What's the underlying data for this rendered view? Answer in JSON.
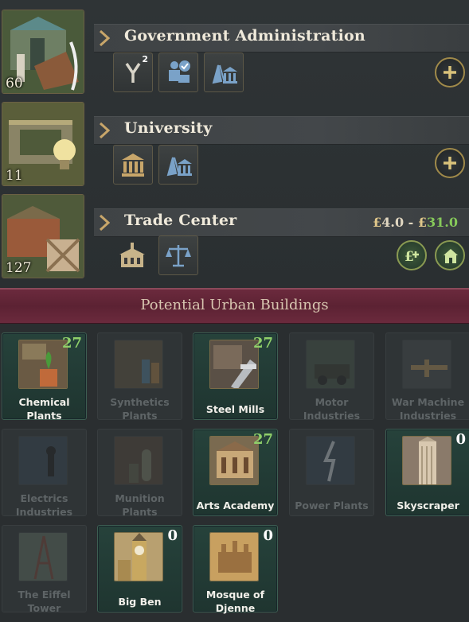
{
  "built": [
    {
      "name": "Government Administration",
      "level": "60",
      "actions": [
        {
          "icon": "branch-icon",
          "badge": "2"
        },
        {
          "icon": "worker-check-icon"
        },
        {
          "icon": "pray-institution-icon"
        }
      ],
      "right": [
        {
          "icon": "plus-icon",
          "style": "gold"
        }
      ]
    },
    {
      "name": "University",
      "level": "11",
      "actions": [
        {
          "icon": "institution-icon"
        },
        {
          "icon": "pray-institution-icon"
        }
      ],
      "right": [
        {
          "icon": "plus-icon",
          "style": "gold"
        }
      ]
    },
    {
      "name": "Trade Center",
      "level": "127",
      "actions": [
        {
          "icon": "building-icon"
        },
        {
          "icon": "scales-icon"
        }
      ],
      "right": [
        {
          "icon": "pound-plus-icon",
          "style": "green"
        },
        {
          "icon": "house-up-icon",
          "style": "green"
        }
      ],
      "value": {
        "currency": "£",
        "low": "4.0",
        "sep": "-",
        "high": "31.0"
      }
    }
  ],
  "potential": {
    "title": "Potential Urban Buildings",
    "cards": [
      {
        "line1": "Chemical",
        "line2": "Plants",
        "count": "27",
        "available": true,
        "count_color": "green"
      },
      {
        "line1": "Synthetics",
        "line2": "Plants",
        "count": "",
        "available": false
      },
      {
        "line1": "Steel Mills",
        "line2": "",
        "count": "27",
        "available": true,
        "count_color": "green"
      },
      {
        "line1": "Motor",
        "line2": "Industries",
        "count": "",
        "available": false
      },
      {
        "line1": "War Machine",
        "line2": "Industries",
        "count": "",
        "available": false
      },
      {
        "line1": "Electrics",
        "line2": "Industries",
        "count": "",
        "available": false
      },
      {
        "line1": "Munition",
        "line2": "Plants",
        "count": "",
        "available": false
      },
      {
        "line1": "Arts Academy",
        "line2": "",
        "count": "27",
        "available": true,
        "count_color": "green"
      },
      {
        "line1": "Power Plants",
        "line2": "",
        "count": "",
        "available": false
      },
      {
        "line1": "Skyscraper",
        "line2": "",
        "count": "0",
        "available": true,
        "count_color": "white"
      },
      {
        "line1": "The Eiffel",
        "line2": "Tower",
        "count": "",
        "available": false
      },
      {
        "line1": "Big Ben",
        "line2": "",
        "count": "0",
        "available": true,
        "count_color": "white"
      },
      {
        "line1": "Mosque of",
        "line2": "Djenne",
        "count": "0",
        "available": true,
        "count_color": "white"
      }
    ]
  },
  "colors": {
    "accent_gold": "#a08a4a",
    "available_card": "#26423b",
    "header_band": "#5c2233",
    "count_green": "#8fd06a"
  }
}
